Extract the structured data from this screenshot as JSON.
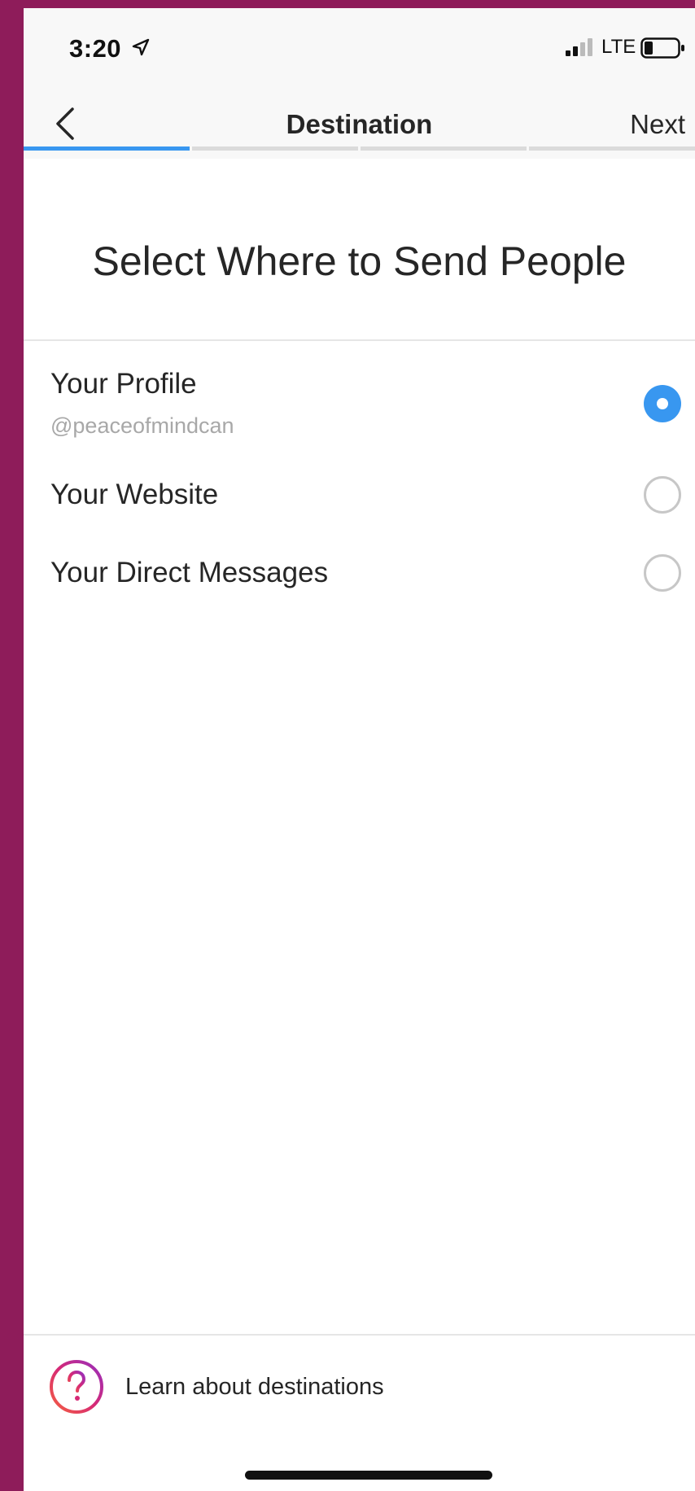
{
  "status_bar": {
    "time": "3:20",
    "network": "LTE",
    "location_icon": "location-arrow-icon",
    "signal_icon": "signal-bars-icon",
    "battery_icon": "battery-icon"
  },
  "nav": {
    "title": "Destination",
    "next_label": "Next",
    "back_icon": "chevron-left-icon",
    "steps_total": 4,
    "step_current": 1,
    "accent_color": "#3897f0"
  },
  "main": {
    "heading": "Select Where to Send People",
    "options": [
      {
        "label": "Your Profile",
        "sublabel": "@peaceofmindcan",
        "selected": true
      },
      {
        "label": "Your Website",
        "sublabel": "",
        "selected": false
      },
      {
        "label": "Your Direct Messages",
        "sublabel": "",
        "selected": false
      }
    ]
  },
  "footer": {
    "learn_label": "Learn about destinations",
    "help_icon": "question-circle-icon"
  },
  "colors": {
    "frame": "#8e1c5a",
    "accent": "#3897f0"
  }
}
